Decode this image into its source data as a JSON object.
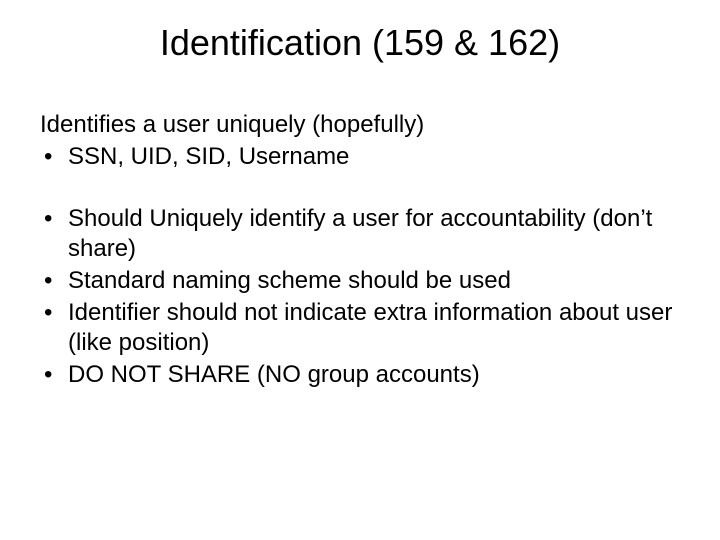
{
  "slide": {
    "title": "Identification (159 & 162)",
    "lead": "Identifies a user uniquely (hopefully)",
    "bullets_a": [
      "SSN, UID, SID, Username"
    ],
    "bullets_b": [
      "Should Uniquely identify a user for accountability (don’t share)",
      "Standard naming scheme should be used",
      "Identifier should not indicate extra information about user (like position)",
      "DO NOT SHARE (NO group accounts)"
    ]
  }
}
